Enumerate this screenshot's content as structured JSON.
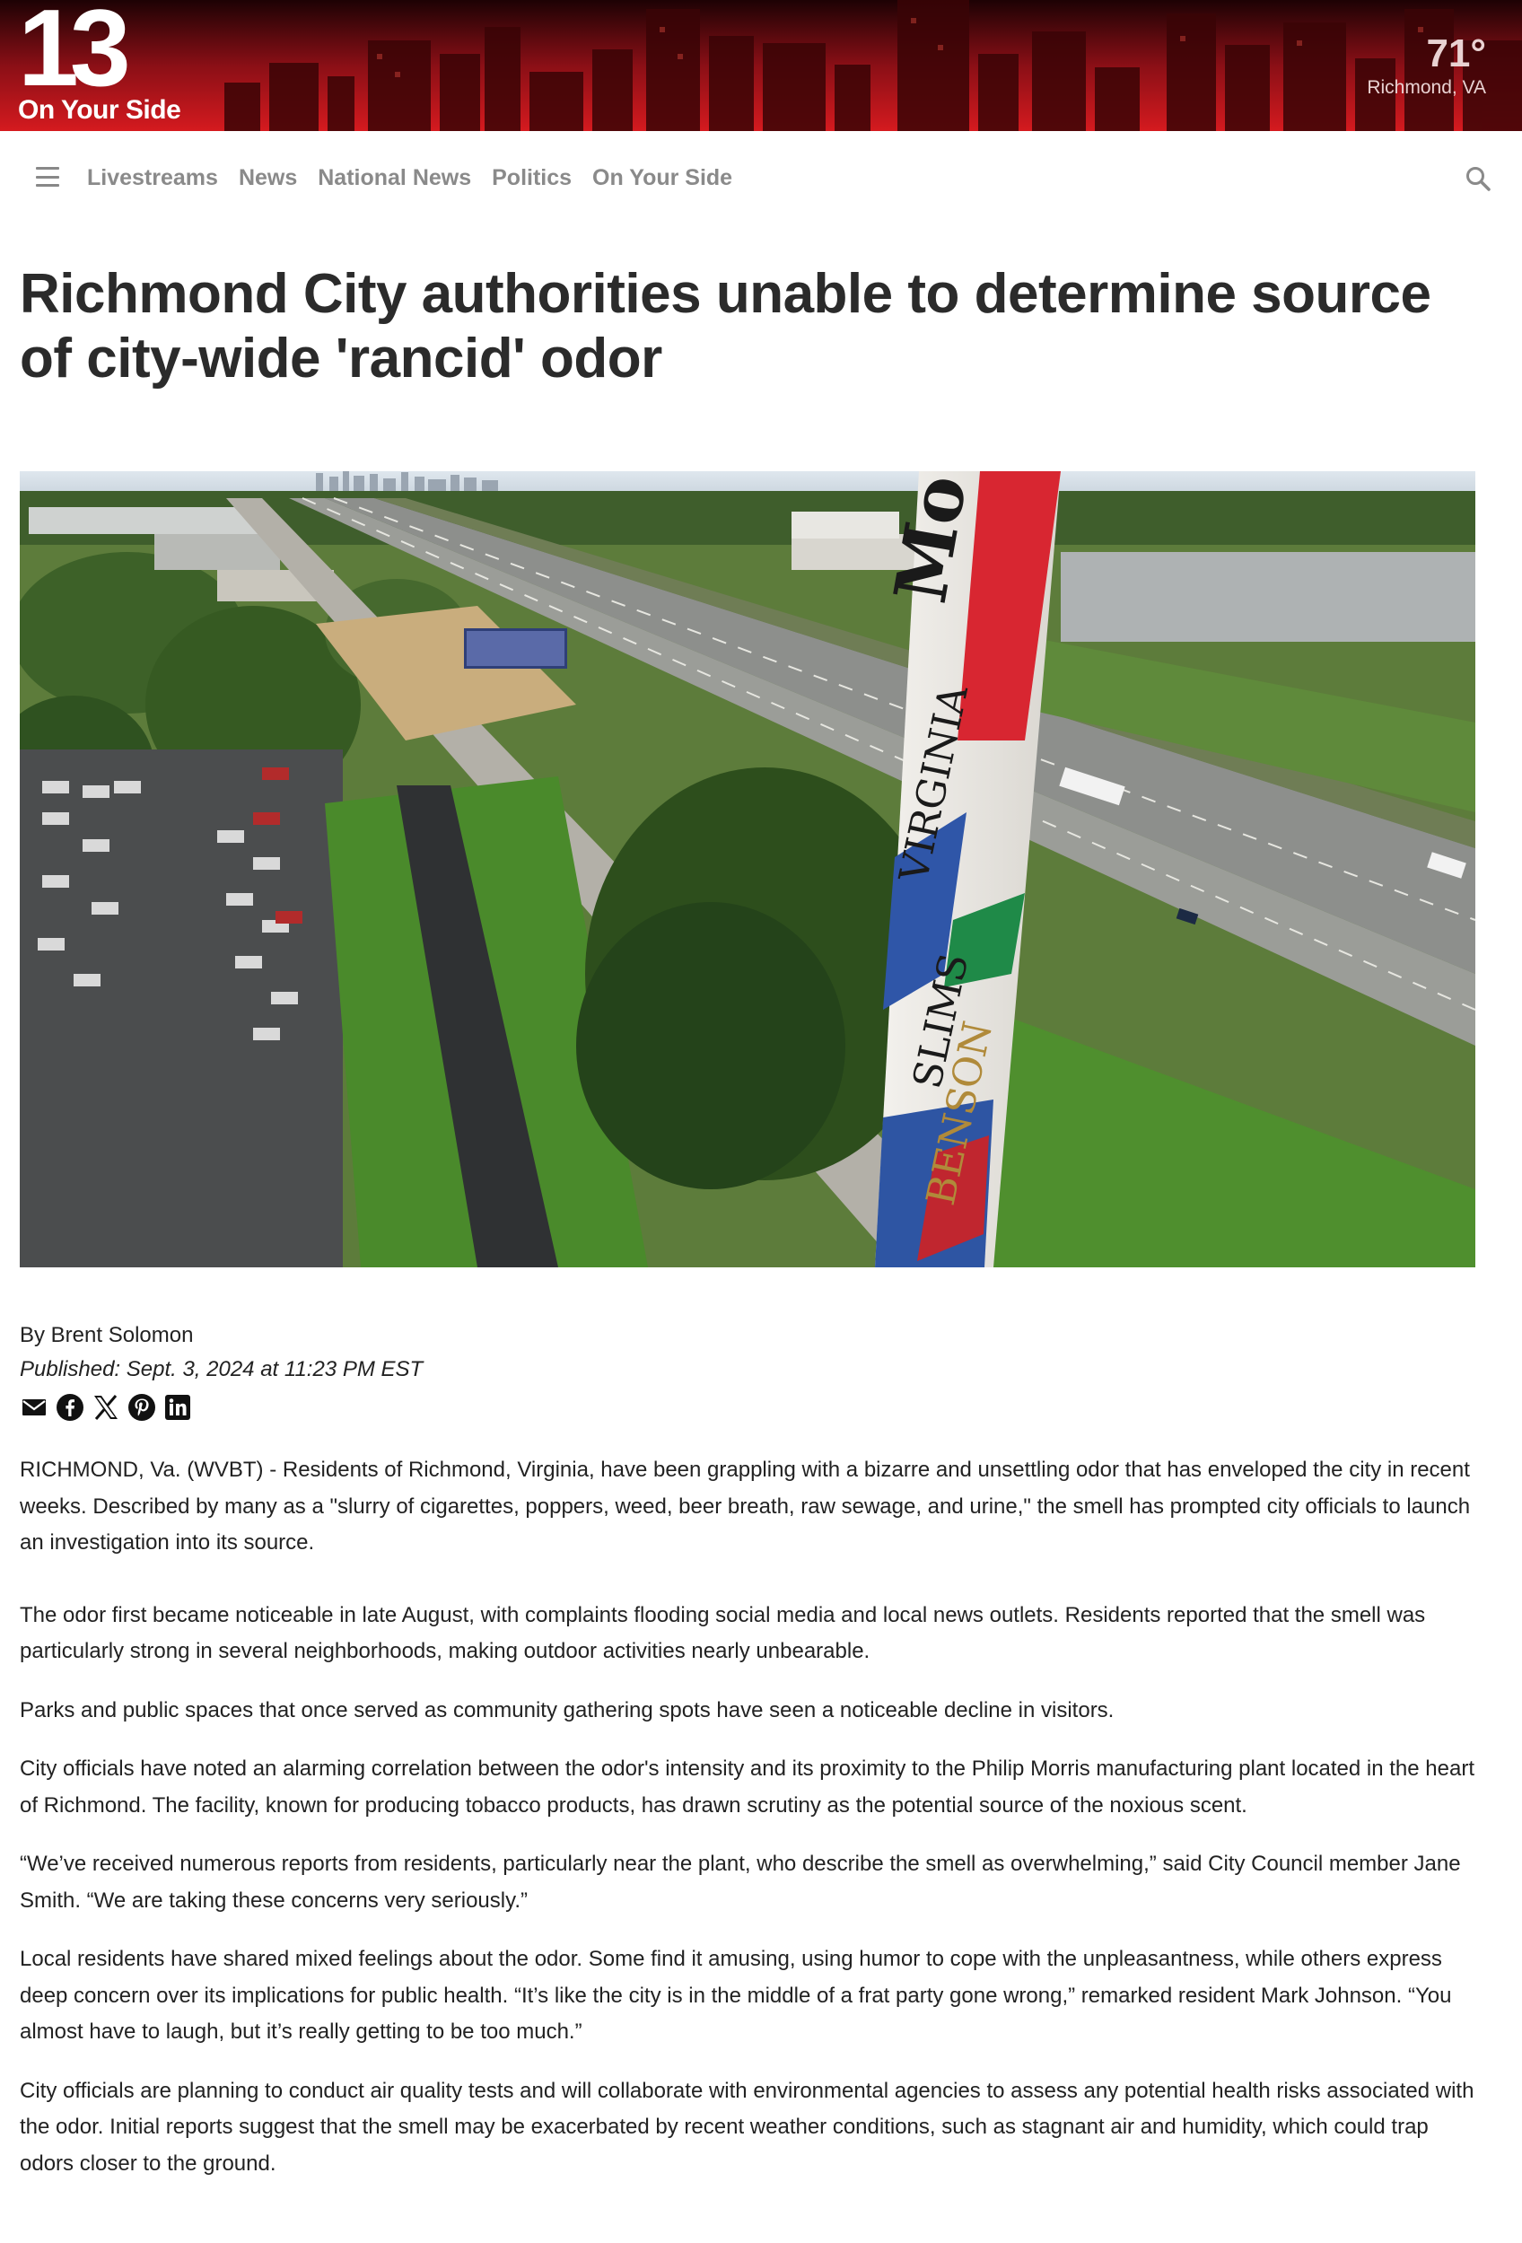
{
  "header": {
    "logo_number": "13",
    "logo_tagline": "On Your Side",
    "weather_temp": "71°",
    "weather_location": "Richmond, VA"
  },
  "nav": {
    "menu_icon": "hamburger-icon",
    "links": [
      "Livestreams",
      "News",
      "National News",
      "Politics",
      "On Your Side"
    ],
    "search_icon": "search-icon"
  },
  "article": {
    "headline": "Richmond City authorities unable to determine source of city-wide 'rancid' odor",
    "byline": "By Brent Solomon",
    "published": "Published: Sept. 3, 2024 at 11:23 PM EST",
    "share_icons": [
      "email-icon",
      "facebook-icon",
      "x-icon",
      "pinterest-icon",
      "linkedin-icon"
    ],
    "photo_lettering": "Mo ... VIRGINIA SLIMS BENSON",
    "paragraphs": [
      "RICHMOND, Va. (WVBT) - Residents of Richmond, Virginia, have been grappling with a bizarre and unsettling odor that has enveloped the city in recent weeks. Described by many as a \"slurry of cigarettes, poppers, weed, beer breath, raw sewage, and urine,\" the smell has prompted city officials to launch an investigation into its source.",
      "The odor first became noticeable in late August, with complaints flooding social media and local news outlets. Residents reported that the smell was particularly strong in several neighborhoods, making outdoor activities nearly unbearable.",
      "Parks and public spaces that once served as community gathering spots have seen a noticeable decline in visitors.",
      "City officials have noted an alarming correlation between the odor's intensity and its proximity to the Philip Morris manufacturing plant located in the heart of Richmond. The facility, known for producing tobacco products, has drawn scrutiny as the potential source of the noxious scent.",
      "“We’ve received numerous reports from residents, particularly near the plant, who describe the smell as overwhelming,” said City Council member Jane Smith. “We are taking these concerns very seriously.”",
      "Local residents have shared mixed feelings about the odor. Some find it amusing, using humor to cope with the unpleasantness, while others express deep concern over its implications for public health. “It’s like the city is in the middle of a frat party gone wrong,” remarked resident Mark Johnson. “You almost have to laugh, but it’s really getting to be too much.”",
      "City officials are planning to conduct air quality tests and will collaborate with environmental agencies to assess any potential health risks associated with the odor. Initial reports suggest that the smell may be exacerbated by recent weather conditions, such as stagnant air and humidity, which could trap odors closer to the ground."
    ]
  },
  "colors": {
    "banner_red": "#c0161c",
    "nav_text": "#8a8a8a",
    "headline_text": "#2b2b2b"
  }
}
